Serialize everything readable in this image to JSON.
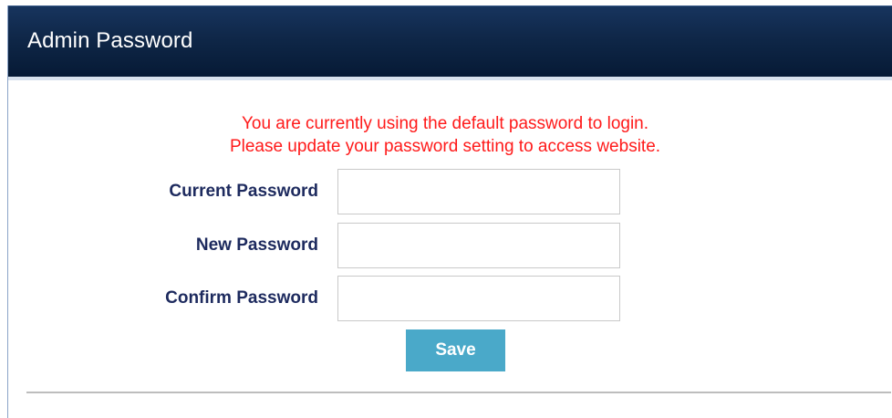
{
  "panel": {
    "title": "Admin Password"
  },
  "notice": {
    "line1": "You are currently using the default password to login.",
    "line2": "Please update your password setting to access website."
  },
  "form": {
    "fields": [
      {
        "label": "Current Password",
        "value": "",
        "type": "password"
      },
      {
        "label": "New Password",
        "value": "",
        "type": "password"
      },
      {
        "label": "Confirm Password",
        "value": "",
        "type": "password"
      }
    ],
    "save_label": "Save"
  },
  "colors": {
    "header_bg": "#0f2748",
    "notice_text": "#ff1a1a",
    "label_text": "#1d2a5e",
    "save_button_bg": "#4aa9c9"
  }
}
